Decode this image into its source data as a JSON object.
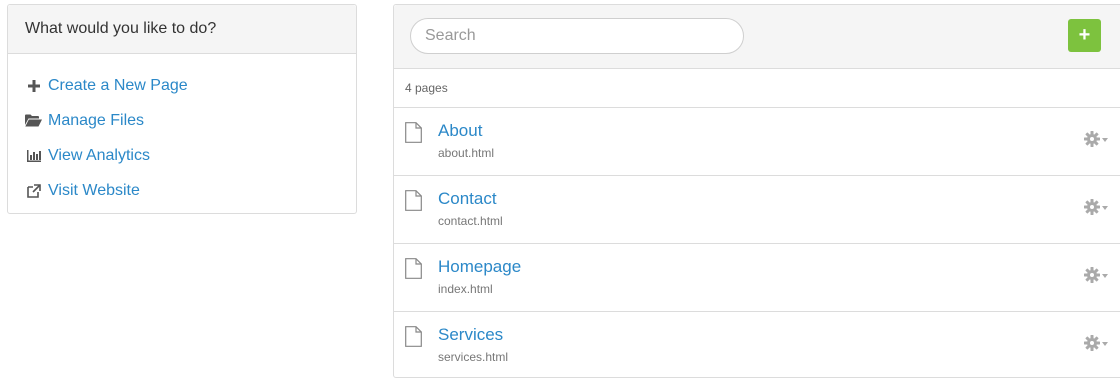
{
  "actions_panel": {
    "heading": "What would you like to do?",
    "items": [
      {
        "label": "Create a New Page",
        "icon": "plus-icon"
      },
      {
        "label": "Manage Files",
        "icon": "folder-open-icon"
      },
      {
        "label": "View Analytics",
        "icon": "bar-chart-icon"
      },
      {
        "label": "Visit Website",
        "icon": "external-link-icon"
      }
    ]
  },
  "pages_panel": {
    "search": {
      "placeholder": "Search",
      "value": ""
    },
    "add_button_label": "+",
    "count_text": "4 pages",
    "pages": [
      {
        "title": "About",
        "file": "about.html"
      },
      {
        "title": "Contact",
        "file": "contact.html"
      },
      {
        "title": "Homepage",
        "file": "index.html"
      },
      {
        "title": "Services",
        "file": "services.html"
      }
    ]
  },
  "colors": {
    "link": "#2b88c8",
    "add_button": "#7dc23e",
    "header_bg": "#f5f5f5",
    "border": "#dcdcdc"
  }
}
